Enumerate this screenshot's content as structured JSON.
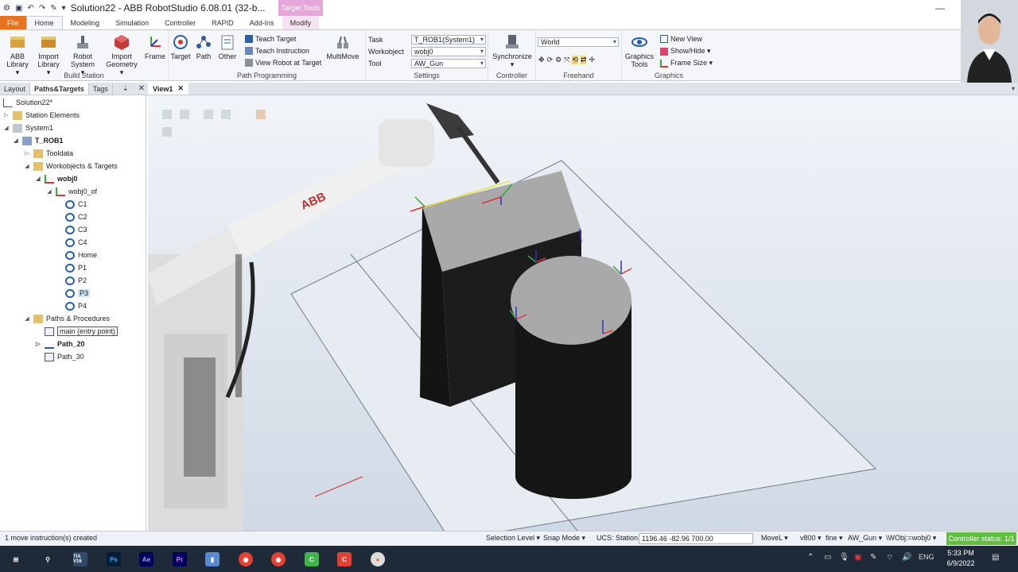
{
  "titlebar": {
    "title": "Solution22 - ABB RobotStudio 6.08.01 (32-b...",
    "contextual_tab_head": "Target Tools"
  },
  "tabs": [
    "File",
    "Home",
    "Modeling",
    "Simulation",
    "Controller",
    "RAPID",
    "Add-Ins",
    "Modify"
  ],
  "ribbon": {
    "build_station": {
      "label": "Build Station",
      "abb_library": [
        "ABB",
        "Library ▾"
      ],
      "import_library": [
        "Import",
        "Library ▾"
      ],
      "robot_system": [
        "Robot",
        "System ▾"
      ],
      "import_geometry": [
        "Import",
        "Geometry ▾"
      ],
      "frame": "Frame"
    },
    "path_programming": {
      "label": "Path Programming",
      "target": "Target",
      "path": "Path",
      "other": "Other",
      "teach_target": "Teach Target",
      "teach_instruction": "Teach Instruction",
      "view_robot_at_target": "View Robot at Target",
      "multimove": "MultiMove"
    },
    "settings": {
      "label": "Settings",
      "task_label": "Task",
      "task_value": "T_ROB1(System1)",
      "workobject_label": "Workobject",
      "workobject_value": "wobj0",
      "tool_label": "Tool",
      "tool_value": "AW_Gun"
    },
    "controller": {
      "label": "Controller",
      "synchronize": "Synchronize ▾"
    },
    "freehand": {
      "label": "Freehand",
      "reference": "World"
    },
    "graphics": {
      "label": "Graphics",
      "graphics_tools": [
        "Graphics",
        "Tools"
      ],
      "new_view": "New View",
      "show_hide": "Show/Hide ▾",
      "frame_size": "Frame Size ▾"
    }
  },
  "panel": {
    "tabs": [
      "Layout",
      "Paths&Targets",
      "Tags"
    ],
    "tree": {
      "solution": "Solution22*",
      "station_elements": "Station Elements",
      "system": "System1",
      "task": "T_ROB1",
      "tooldata": "Tooldata",
      "workobjects": "Workobjects & Targets",
      "wobj0": "wobj0",
      "wobj0_of": "wobj0_of",
      "targets": [
        "C1",
        "C2",
        "C3",
        "C4",
        "Home",
        "P1",
        "P2",
        "P3",
        "P4"
      ],
      "paths_procedures": "Paths & Procedures",
      "main": "main (entry point)",
      "path_20": "Path_20",
      "path_30": "Path_30"
    }
  },
  "view": {
    "tab": "View1",
    "logo_text": "ABB"
  },
  "statusbar": {
    "message": "1 move instruction(s) created",
    "selection_level": "Selection Level ▾",
    "snap_mode": "Snap Mode ▾",
    "ucs": "UCS: Station",
    "coords": "1196.46  -82.96  700.00",
    "movel": "MoveL ▾",
    "speed": "v800 ▾",
    "zone": "fine ▾",
    "tool": "AW_Gun ▾",
    "wobj": "\\WObj:=wobj0 ▾",
    "controller_status": "Controller status: 1/1"
  },
  "taskbar": {
    "apps": [
      "TIA V16",
      "Ps",
      "Ae",
      "Pr"
    ],
    "language": "ENG",
    "time": "5:33 PM",
    "date": "6/9/2022"
  },
  "colors": {
    "file_tab": "#e8731f",
    "contextual_tab": "#e7a6d9",
    "controller_ok": "#5fbf3e",
    "taskbar": "#1f2a38"
  }
}
